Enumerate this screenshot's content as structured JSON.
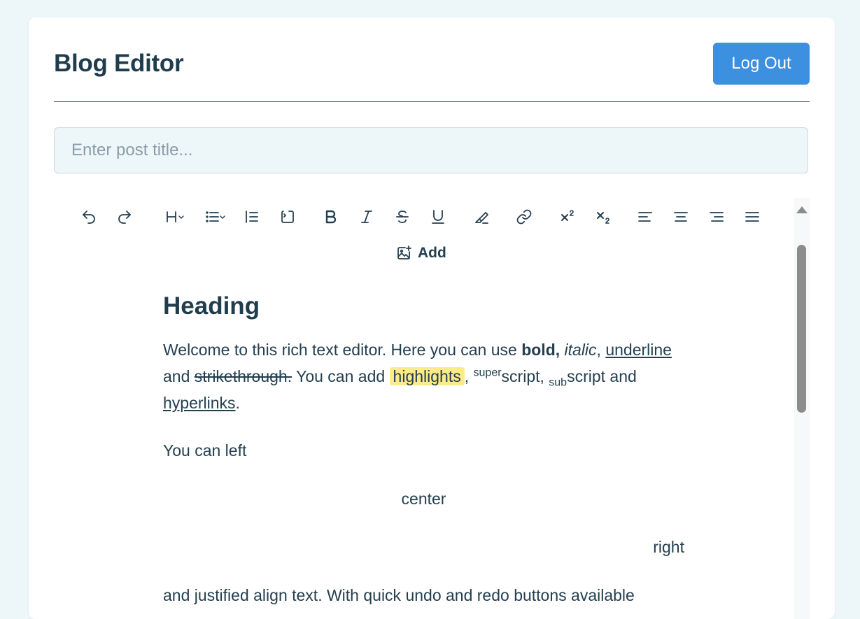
{
  "header": {
    "title": "Blog Editor",
    "logout_label": "Log Out"
  },
  "post": {
    "title_placeholder": "Enter post title...",
    "title_value": ""
  },
  "toolbar": {
    "items": [
      {
        "name": "undo-icon"
      },
      {
        "name": "redo-icon"
      },
      {
        "name": "heading-dropdown-icon"
      },
      {
        "name": "list-dropdown-icon"
      },
      {
        "name": "blockquote-icon"
      },
      {
        "name": "code-block-icon"
      },
      {
        "name": "bold-icon"
      },
      {
        "name": "italic-icon"
      },
      {
        "name": "strikethrough-icon"
      },
      {
        "name": "underline-icon"
      },
      {
        "name": "highlighter-icon"
      },
      {
        "name": "link-icon"
      },
      {
        "name": "superscript-icon"
      },
      {
        "name": "subscript-icon"
      },
      {
        "name": "align-left-icon"
      },
      {
        "name": "align-center-icon"
      },
      {
        "name": "align-right-icon"
      },
      {
        "name": "align-justify-icon"
      }
    ],
    "add_label": "Add"
  },
  "content": {
    "heading": "Heading",
    "intro": {
      "t1": "Welcome to this rich text editor. Here you can use ",
      "bold": "bold,",
      "t2": " ",
      "italic": "italic",
      "t3": ", ",
      "underline": "underline",
      "t4": " and ",
      "strike": "strikethrough.",
      "t5": " You can add ",
      "highlight": "highlights",
      "t6": ", ",
      "sup": "super",
      "t7": "script, ",
      "sub": "sub",
      "t8": "script and ",
      "link": "hyperlinks",
      "t9": "."
    },
    "left": "You can left",
    "center": "center",
    "right": "right",
    "justified": "and justified align text. With quick undo and redo buttons available"
  },
  "colors": {
    "accent": "#3d8fe0",
    "highlight": "#fceb87",
    "background": "#edf6f9",
    "text": "#243f50"
  }
}
